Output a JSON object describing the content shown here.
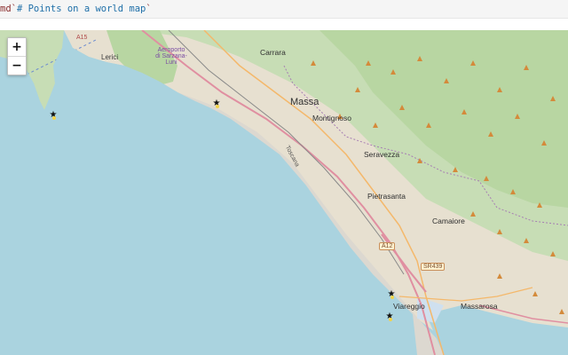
{
  "cell": {
    "code_prefix": "md`",
    "code_text": "# Points on a world map",
    "code_suffix": "`"
  },
  "map": {
    "zoom_in_label": "+",
    "zoom_out_label": "−",
    "places": {
      "carrara": "Carrara",
      "massa": "Massa",
      "montignoso": "Montignoso",
      "seravezza": "Seravezza",
      "pietrasanta": "Pietrasanta",
      "camaiore": "Camaiore",
      "viareggio": "Viareggio",
      "massarosa": "Massarosa",
      "lerici": "Lerici",
      "airport": "Aeroporto di Sarzana-Luni",
      "toscana": "Toscana"
    },
    "roads": {
      "a12": "A12",
      "sr439": "SR439",
      "a15": "A15"
    },
    "marker_glyph": "★",
    "marker_count": 4
  }
}
